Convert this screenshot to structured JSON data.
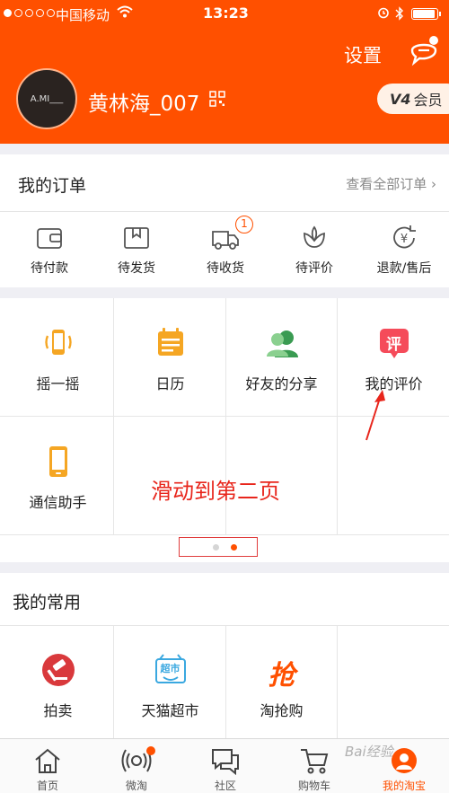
{
  "status_bar": {
    "carrier": "中国移动",
    "time": "13:23"
  },
  "header": {
    "settings_label": "设置",
    "avatar_text": "A.MI___",
    "username": "黄林海_007",
    "vip_level": "V4",
    "vip_label": "会员"
  },
  "orders": {
    "title": "我的订单",
    "view_all": "查看全部订单",
    "items": [
      {
        "label": "待付款",
        "icon": "wallet-icon"
      },
      {
        "label": "待发货",
        "icon": "package-icon"
      },
      {
        "label": "待收货",
        "icon": "truck-icon",
        "badge": "1"
      },
      {
        "label": "待评价",
        "icon": "lotus-icon"
      },
      {
        "label": "退款/售后",
        "icon": "refund-icon"
      }
    ]
  },
  "tools": {
    "items": [
      {
        "label": "摇一摇",
        "icon": "shake-phone-icon"
      },
      {
        "label": "日历",
        "icon": "calendar-icon"
      },
      {
        "label": "好友的分享",
        "icon": "friends-share-icon"
      },
      {
        "label": "我的评价",
        "icon": "review-icon",
        "icon_text": "评"
      },
      {
        "label": "通信助手",
        "icon": "phone-assistant-icon"
      }
    ],
    "annotation": "滑动到第二页",
    "page_indicator": {
      "pages": 2,
      "current": 2
    }
  },
  "common": {
    "title": "我的常用",
    "items": [
      {
        "label": "拍卖",
        "icon": "auction-icon"
      },
      {
        "label": "天猫超市",
        "icon": "tmall-market-icon",
        "icon_text": "超市"
      },
      {
        "label": "淘抢购",
        "icon": "flash-sale-icon",
        "icon_text": "抢"
      }
    ]
  },
  "tabbar": {
    "items": [
      {
        "label": "首页",
        "icon": "home-icon"
      },
      {
        "label": "微淘",
        "icon": "broadcast-icon"
      },
      {
        "label": "社区",
        "icon": "chat-icon"
      },
      {
        "label": "购物车",
        "icon": "cart-icon"
      },
      {
        "label": "我的淘宝",
        "icon": "my-taobao-icon",
        "active": true
      }
    ]
  },
  "watermark": "Bai经验",
  "colors": {
    "brand": "#ff5000",
    "annotation": "#e8261c"
  }
}
